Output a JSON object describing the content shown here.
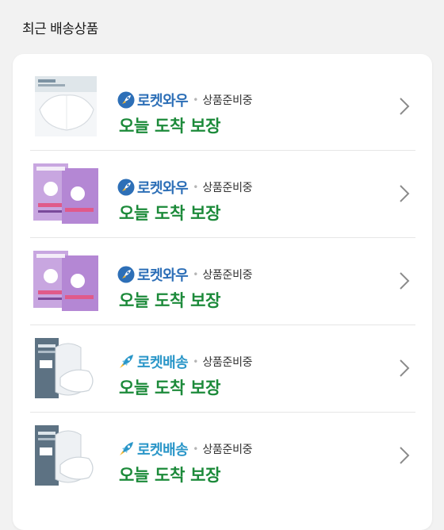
{
  "section": {
    "title": "최근 배송상품"
  },
  "colors": {
    "wow_blue": "#2d6fb7",
    "rocket_cyan": "#2a96c8",
    "delivery_green": "#1c8a3a"
  },
  "items": [
    {
      "badge": "로켓와우",
      "badge_kind": "wow",
      "status": "상품준비중",
      "delivery": "오늘 도착 보장",
      "product_icon": "white-mask-pack-icon"
    },
    {
      "badge": "로켓와우",
      "badge_kind": "wow",
      "status": "상품준비중",
      "delivery": "오늘 도착 보장",
      "product_icon": "purple-kids-mask-box-icon"
    },
    {
      "badge": "로켓와우",
      "badge_kind": "wow",
      "status": "상품준비중",
      "delivery": "오늘 도착 보장",
      "product_icon": "purple-kids-mask-box-icon"
    },
    {
      "badge": "로켓배송",
      "badge_kind": "rocket",
      "status": "상품준비중",
      "delivery": "오늘 도착 보장",
      "product_icon": "grey-mask-pack-icon"
    },
    {
      "badge": "로켓배송",
      "badge_kind": "rocket",
      "status": "상품준비중",
      "delivery": "오늘 도착 보장",
      "product_icon": "grey-mask-pack-icon"
    }
  ]
}
